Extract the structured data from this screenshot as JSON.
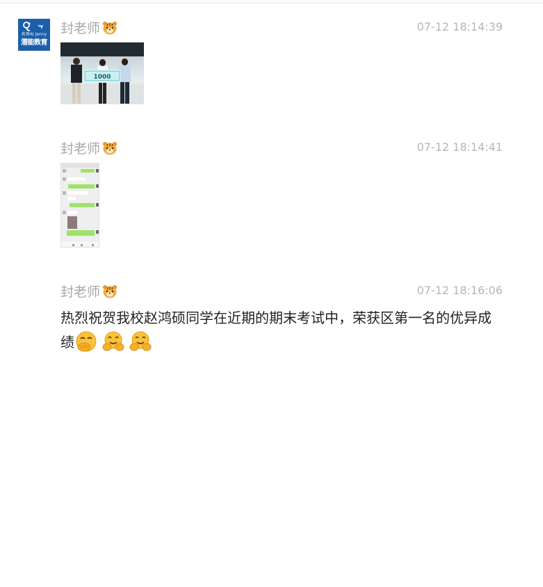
{
  "avatar": {
    "sub_text": "名师AI  Jenny",
    "brand": "潜能教育"
  },
  "messages": [
    {
      "sender": "封老师",
      "time": "07-12 18:14:39",
      "type": "image",
      "image_banner_text": "1000"
    },
    {
      "sender": "封老师",
      "time": "07-12 18:14:41",
      "type": "image"
    },
    {
      "sender": "封老师",
      "time": "07-12 18:16:06",
      "type": "text",
      "text": "热烈祝贺我校赵鸿硕同学在近期的期末考试中，荣获区第一名的优异成绩",
      "emojis": [
        "face-with-hand-over-mouth",
        "hugging-face",
        "hugging-face"
      ]
    }
  ],
  "colors": {
    "sender": "#a8a8a8",
    "time": "#b6b6b6",
    "text": "#222222",
    "avatar_bg": "#1b5fa8"
  }
}
